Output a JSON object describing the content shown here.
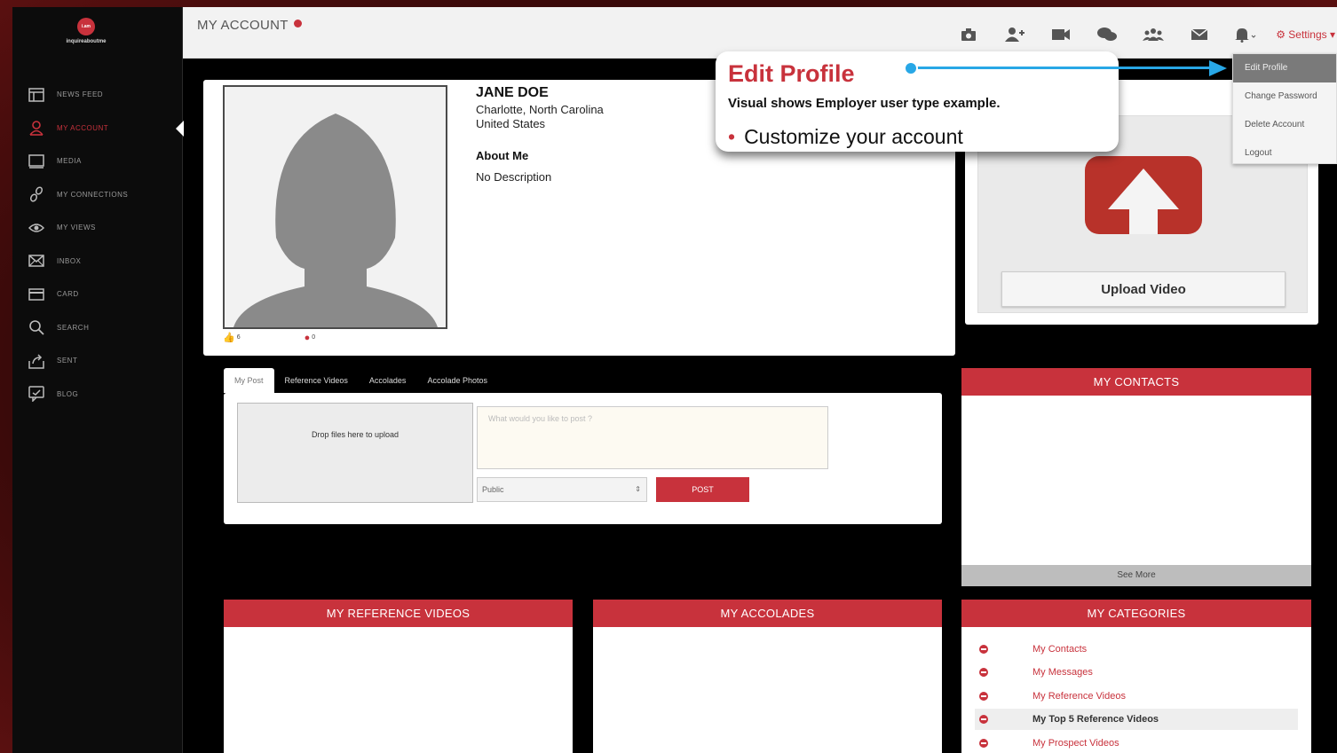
{
  "logo": {
    "badge": "i.am",
    "name": "inquireaboutme"
  },
  "sidebar": {
    "items": [
      {
        "label": "NEWS FEED",
        "icon": "news-icon"
      },
      {
        "label": "MY ACCOUNT",
        "icon": "user-icon"
      },
      {
        "label": "MEDIA",
        "icon": "media-icon"
      },
      {
        "label": "MY CONNECTIONS",
        "icon": "link-icon"
      },
      {
        "label": "MY VIEWS",
        "icon": "eye-icon"
      },
      {
        "label": "INBOX",
        "icon": "envelope-icon"
      },
      {
        "label": "CARD",
        "icon": "card-icon"
      },
      {
        "label": "SEARCH",
        "icon": "search-icon"
      },
      {
        "label": "SENT",
        "icon": "share-icon"
      },
      {
        "label": "BLOG",
        "icon": "blog-icon"
      }
    ]
  },
  "header": {
    "title": "MY ACCOUNT",
    "settings": "Settings"
  },
  "settings_menu": [
    "Edit Profile",
    "Change Password",
    "Delete Account",
    "Logout"
  ],
  "profile": {
    "name": "JANE DOE",
    "city": "Charlotte, North Carolina",
    "country": "United States",
    "about_heading": "About Me",
    "about_text": "No Description",
    "likes": "6",
    "comments": "0"
  },
  "upload": {
    "button": "Upload Video"
  },
  "post": {
    "tabs": [
      "My Post",
      "Reference Videos",
      "Accolades",
      "Accolade Photos"
    ],
    "drop_text": "Drop files here to upload",
    "placeholder": "What would you like to post ?",
    "privacy": "Public",
    "post_button": "POST"
  },
  "contacts": {
    "title": "MY CONTACTS",
    "see_more": "See More"
  },
  "reference_videos": {
    "title": "MY REFERENCE VIDEOS"
  },
  "accolades": {
    "title": "MY ACCOLADES"
  },
  "categories": {
    "title": "MY CATEGORIES",
    "items": [
      "My Contacts",
      "My Messages",
      "My Reference Videos",
      "My Top 5 Reference Videos",
      "My Prospect Videos"
    ]
  },
  "callout": {
    "title": "Edit Profile",
    "subtitle": "Visual shows Employer user type example.",
    "bullet": "Customize your account"
  },
  "colors": {
    "accent": "#c8323c",
    "pointer": "#28a7e6"
  }
}
